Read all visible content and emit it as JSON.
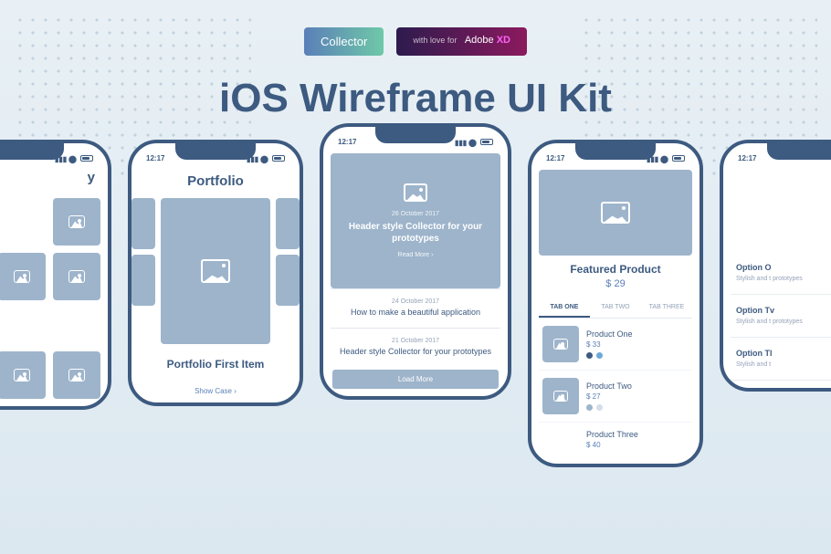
{
  "badges": {
    "collector": "Collector",
    "adobe_prefix": "with love for",
    "adobe_main": "Adobe",
    "adobe_xd": "XD"
  },
  "title": "iOS Wireframe UI Kit",
  "status_time": "12:17",
  "phone_category": {
    "title_partial": "y"
  },
  "phone_portfolio": {
    "title": "Portfolio",
    "item_label": "Portfolio First Item",
    "link": "Show Case  ›"
  },
  "phone_articles": {
    "hero_date": "26 October 2017",
    "hero_title": "Header style Collector for your prototypes",
    "hero_link": "Read More  ›",
    "article1_date": "24 October 2017",
    "article1_title": "How to make a beautiful application",
    "article2_date": "21 October 2017",
    "article2_title": "Header style Collector for your prototypes",
    "load_more": "Load More"
  },
  "phone_products": {
    "featured_title": "Featured Product",
    "featured_price": "$ 29",
    "tabs": [
      "TAB ONE",
      "TAB TWO",
      "TAB THREE"
    ],
    "products": [
      {
        "name": "Product One",
        "price": "$ 33",
        "colors": [
          "#3d5a80",
          "#6fa8d8"
        ]
      },
      {
        "name": "Product Two",
        "price": "$ 27",
        "colors": [
          "#9db4cb",
          "#d4dde8"
        ]
      },
      {
        "name": "Product Three",
        "price": "$ 40"
      }
    ]
  },
  "phone_options": {
    "items": [
      {
        "title": "Option O",
        "sub": "Stylish and t\nprototypes"
      },
      {
        "title": "Option Tv",
        "sub": "Stylish and t\nprototypes"
      },
      {
        "title": "Option Tl",
        "sub": "Stylish and t"
      }
    ]
  }
}
